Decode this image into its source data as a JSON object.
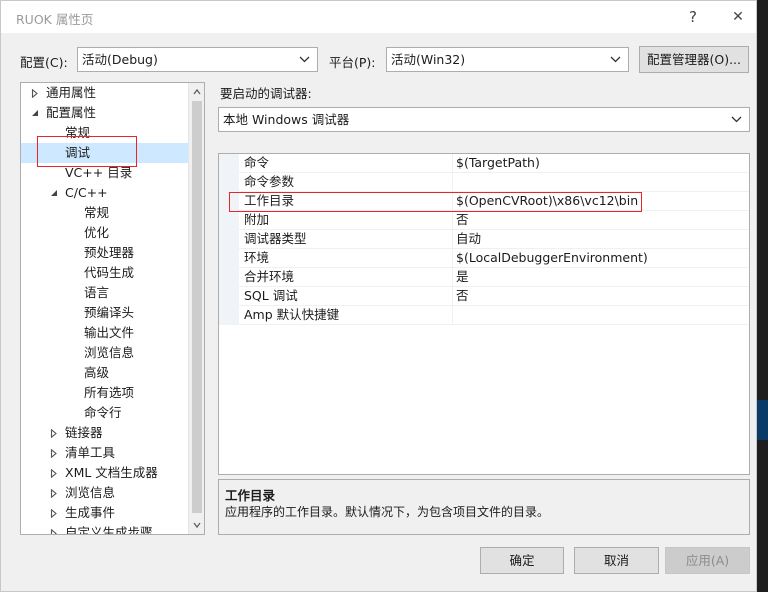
{
  "window": {
    "title": "RUOK 属性页",
    "help": "?",
    "close": "✕"
  },
  "toolbar": {
    "config_label": "配置(C):",
    "config_value": "活动(Debug)",
    "platform_label": "平台(P):",
    "platform_value": "活动(Win32)",
    "config_manager": "配置管理器(O)..."
  },
  "debugger": {
    "label": "要启动的调试器:",
    "value": "本地 Windows 调试器"
  },
  "tree": {
    "items": [
      {
        "label": "通用属性",
        "state": "collapsed"
      },
      {
        "label": "配置属性",
        "state": "expanded"
      },
      {
        "label": "常规",
        "state": "leaf"
      },
      {
        "label": "调试",
        "state": "leaf",
        "selected": true
      },
      {
        "label": "VC++ 目录",
        "state": "leaf"
      },
      {
        "label": "C/C++",
        "state": "expanded"
      },
      {
        "label": "常规",
        "state": "leaf"
      },
      {
        "label": "优化",
        "state": "leaf"
      },
      {
        "label": "预处理器",
        "state": "leaf"
      },
      {
        "label": "代码生成",
        "state": "leaf"
      },
      {
        "label": "语言",
        "state": "leaf"
      },
      {
        "label": "预编译头",
        "state": "leaf"
      },
      {
        "label": "输出文件",
        "state": "leaf"
      },
      {
        "label": "浏览信息",
        "state": "leaf"
      },
      {
        "label": "高级",
        "state": "leaf"
      },
      {
        "label": "所有选项",
        "state": "leaf"
      },
      {
        "label": "命令行",
        "state": "leaf"
      },
      {
        "label": "链接器",
        "state": "collapsed"
      },
      {
        "label": "清单工具",
        "state": "collapsed"
      },
      {
        "label": "XML 文档生成器",
        "state": "collapsed"
      },
      {
        "label": "浏览信息",
        "state": "collapsed"
      },
      {
        "label": "生成事件",
        "state": "collapsed"
      },
      {
        "label": "自定义生成步骤",
        "state": "collapsed"
      }
    ]
  },
  "properties": {
    "rows": [
      {
        "key": "命令",
        "value": "$(TargetPath)"
      },
      {
        "key": "命令参数",
        "value": ""
      },
      {
        "key": "工作目录",
        "value": "$(OpenCVRoot)\\x86\\vc12\\bin"
      },
      {
        "key": "附加",
        "value": "否"
      },
      {
        "key": "调试器类型",
        "value": "自动"
      },
      {
        "key": "环境",
        "value": "$(LocalDebuggerEnvironment)"
      },
      {
        "key": "合并环境",
        "value": "是"
      },
      {
        "key": "SQL 调试",
        "value": "否"
      },
      {
        "key": "Amp 默认快捷键",
        "value": ""
      }
    ]
  },
  "description": {
    "title": "工作目录",
    "text": "应用程序的工作目录。默认情况下，为包含项目文件的目录。"
  },
  "buttons": {
    "ok": "确定",
    "cancel": "取消",
    "apply": "应用(A)"
  },
  "colors": {
    "highlight": "#e8262a",
    "selection": "#cde8ff"
  }
}
